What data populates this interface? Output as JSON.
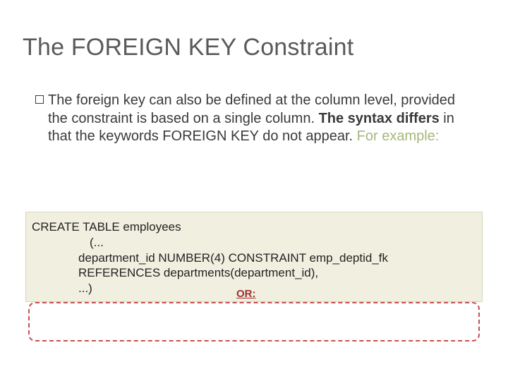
{
  "title": "The FOREIGN KEY Constraint",
  "body": {
    "part1": "The foreign key can also be defined at the column level, provided the constraint is based on a single column. ",
    "bold": "The syntax differs",
    "part2": " in that the keywords FOREIGN KEY do not appear. ",
    "example_label": "For example:"
  },
  "code": {
    "l1": "CREATE TABLE employees",
    "l2": "(...",
    "l3": "department_id NUMBER(4) CONSTRAINT emp_deptid_fk",
    "l4": "REFERENCES departments(department_id),",
    "l5": "...)",
    "or_label": "OR:"
  }
}
